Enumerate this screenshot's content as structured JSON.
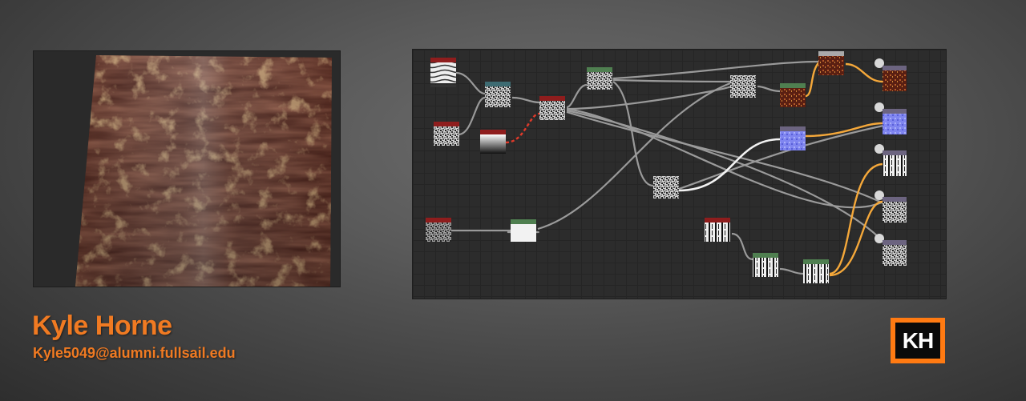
{
  "author": {
    "name": "Kyle Horne",
    "email": "Kyle5049@alumni.fullsail.edu"
  },
  "logo": {
    "text": "KH"
  },
  "colors": {
    "accent": "#f07a22",
    "logo_orange": "#ff7a12",
    "node_header_red": "#8f1d1d",
    "node_header_teal": "#3d6b72",
    "node_header_green": "#4f7f50",
    "node_header_purple": "#6c6480",
    "link_orange": "#f5a83a",
    "link_selected_red": "#e03a2a"
  },
  "icons": {
    "output_node": "output-node-icon",
    "logo": "kh-logo-icon"
  }
}
